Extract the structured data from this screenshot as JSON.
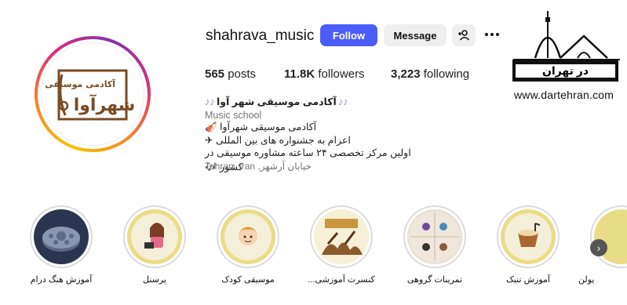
{
  "profile": {
    "username": "shahrava_music",
    "follow_label": "Follow",
    "message_label": "Message",
    "add_user_icon": "add-user-icon",
    "more_icon": "more-options-icon",
    "avatar_logo_text": "آکادمی موسیقی شهرآوا",
    "stats": {
      "posts_count": "565",
      "posts_label": "posts",
      "followers_count": "11.8K",
      "followers_label": "followers",
      "following_count": "3,223",
      "following_label": "following"
    },
    "bio": {
      "name": "آکادمی موسیقی شهر آوا",
      "category": "Music school",
      "line1": "آکادمی موسیقی شهرآوا 🎻",
      "line2": "اعزام به جشنواره های بین المللی ✈",
      "line3": "اولین مرکز تخصصی ۲۴ ساعته مشاوره موسیقی در کشور 🎶",
      "location": "Tehran, Iran ,خیابان آرشهر"
    }
  },
  "watermark": {
    "title": "در تهران",
    "url": "www.dartehran.com"
  },
  "highlights": [
    {
      "label": "آموزش هنگ درام"
    },
    {
      "label": "پرسنل"
    },
    {
      "label": "موسیقی کودک"
    },
    {
      "label": "کنسرت آموزشی..."
    },
    {
      "label": "تمرینات گروهی"
    },
    {
      "label": "آموزش تنبک"
    },
    {
      "label": "یولن"
    }
  ],
  "colors": {
    "follow_button": "#4a5df9",
    "highlight_ring_yellow": "#e6d46a",
    "logo_brown": "#7a4b22"
  }
}
